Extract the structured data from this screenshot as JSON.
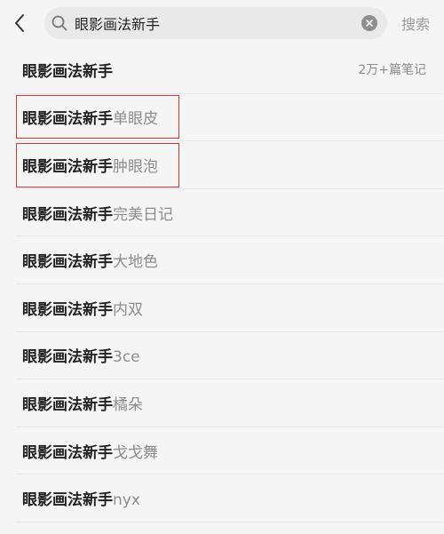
{
  "header": {
    "back_icon": "chevron-left-icon",
    "search_query": "眼影画法新手",
    "search_icon": "search-icon",
    "clear_icon": "clear-circle-icon",
    "search_button_label": "搜索"
  },
  "suggestions": [
    {
      "query": "眼影画法新手",
      "suffix": "",
      "count": "2万+篇笔记"
    },
    {
      "query": "眼影画法新手",
      "suffix": "单眼皮",
      "count": ""
    },
    {
      "query": "眼影画法新手",
      "suffix": "肿眼泡",
      "count": ""
    },
    {
      "query": "眼影画法新手",
      "suffix": "完美日记",
      "count": ""
    },
    {
      "query": "眼影画法新手",
      "suffix": "大地色",
      "count": ""
    },
    {
      "query": "眼影画法新手",
      "suffix": "内双",
      "count": ""
    },
    {
      "query": "眼影画法新手",
      "suffix": "3ce",
      "count": ""
    },
    {
      "query": "眼影画法新手",
      "suffix": "橘朵",
      "count": ""
    },
    {
      "query": "眼影画法新手",
      "suffix": "戈戈舞",
      "count": ""
    },
    {
      "query": "眼影画法新手",
      "suffix": "nyx",
      "count": ""
    }
  ],
  "annotation": {
    "highlight_color": "#d43a3a",
    "highlighted_rows": [
      1,
      2
    ]
  }
}
